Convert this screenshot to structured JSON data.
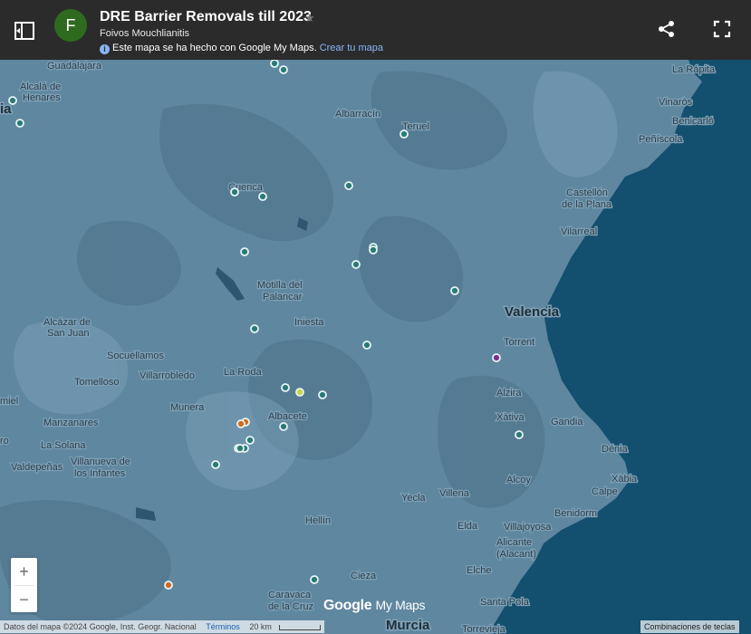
{
  "header": {
    "avatar_letter": "F",
    "title": "DRE Barrier Removals till 2023",
    "owner": "Foivos Mouchlianitis",
    "note": "Este mapa se ha hecho con Google My Maps.",
    "note_link": "Crear tu mapa"
  },
  "controls": {
    "zoom_in": "+",
    "zoom_out": "−"
  },
  "footer": {
    "attribution": "Datos del mapa ©2024 Google, Inst. Geogr. Nacional",
    "terms": "Términos",
    "scale": "20 km",
    "shortcuts": "Combinaciones de teclas"
  },
  "logo": {
    "google": "Google",
    "mymaps": "My Maps"
  },
  "colors": {
    "land": "#5f87a0",
    "land_dark": "#4d7189",
    "sea": "#134f6e",
    "marker_white": "#e8f3f3",
    "marker_teal": "#2a7a78",
    "marker_orange": "#d2691e",
    "marker_yellow": "#c8d640",
    "marker_purple": "#7b2d8e",
    "marker_cyan": "#5bc6d6"
  },
  "places": [
    {
      "name": "Guadalajara",
      "size": "md"
    },
    {
      "name": "Alcalá de",
      "size": "md"
    },
    {
      "name": "Henares",
      "size": "md"
    },
    {
      "name": "La Rápita",
      "size": "md"
    },
    {
      "name": "Vinaròs",
      "size": "md"
    },
    {
      "name": "Benicarló",
      "size": "md"
    },
    {
      "name": "Peñíscola",
      "size": "md"
    },
    {
      "name": "Albarracín",
      "size": "md"
    },
    {
      "name": "Teruel",
      "size": "md"
    },
    {
      "name": "Cuenca",
      "size": "md"
    },
    {
      "name": "Castellón",
      "size": "md"
    },
    {
      "name": "de la Plana",
      "size": "md"
    },
    {
      "name": "Vilarreal",
      "size": "md"
    },
    {
      "name": "Motilla del",
      "size": "md"
    },
    {
      "name": "Palancar",
      "size": "md"
    },
    {
      "name": "Valencia",
      "size": "lg"
    },
    {
      "name": "Alcázar de",
      "size": "md"
    },
    {
      "name": "San Juan",
      "size": "md"
    },
    {
      "name": "Iniesta",
      "size": "md"
    },
    {
      "name": "Torrent",
      "size": "md"
    },
    {
      "name": "Socuéllamos",
      "size": "md"
    },
    {
      "name": "Villarrobledo",
      "size": "md"
    },
    {
      "name": "Tomelloso",
      "size": "md"
    },
    {
      "name": "La Roda",
      "size": "md"
    },
    {
      "name": "Alzira",
      "size": "md"
    },
    {
      "name": "miel",
      "size": "md"
    },
    {
      "name": "Munera",
      "size": "md"
    },
    {
      "name": "Albacete",
      "size": "md"
    },
    {
      "name": "Xàtiva",
      "size": "md"
    },
    {
      "name": "Gandia",
      "size": "md"
    },
    {
      "name": "Manzanares",
      "size": "md"
    },
    {
      "name": "La Solana",
      "size": "md"
    },
    {
      "name": "Dénia",
      "size": "md"
    },
    {
      "name": "Valdepeñas",
      "size": "md"
    },
    {
      "name": "Villanueva de",
      "size": "md"
    },
    {
      "name": "los Infantes",
      "size": "md"
    },
    {
      "name": "Xàbia",
      "size": "md"
    },
    {
      "name": "Alcoy",
      "size": "md"
    },
    {
      "name": "Calpe",
      "size": "md"
    },
    {
      "name": "Yecla",
      "size": "md"
    },
    {
      "name": "Villena",
      "size": "md"
    },
    {
      "name": "Benidorm",
      "size": "md"
    },
    {
      "name": "Hellín",
      "size": "md"
    },
    {
      "name": "Elda",
      "size": "md"
    },
    {
      "name": "Villajoyosa",
      "size": "md"
    },
    {
      "name": "Alicante",
      "size": "md"
    },
    {
      "name": "(Alacant)",
      "size": "md"
    },
    {
      "name": "Elche",
      "size": "md"
    },
    {
      "name": "Cieza",
      "size": "md"
    },
    {
      "name": "Caravaca",
      "size": "md"
    },
    {
      "name": "de la Cruz",
      "size": "md"
    },
    {
      "name": "Santa Pola",
      "size": "md"
    },
    {
      "name": "Murcia",
      "size": "lg"
    },
    {
      "name": "Torrevieja",
      "size": "md"
    },
    {
      "name": "ia",
      "size": "lg"
    },
    {
      "name": "ro",
      "size": "md"
    }
  ],
  "markers": [
    {
      "color": "white"
    },
    {
      "color": "white"
    },
    {
      "color": "white"
    },
    {
      "color": "white"
    },
    {
      "color": "white"
    },
    {
      "color": "teal"
    },
    {
      "color": "white"
    },
    {
      "color": "white"
    },
    {
      "color": "white"
    },
    {
      "color": "white"
    },
    {
      "color": "white"
    },
    {
      "color": "white"
    },
    {
      "color": "white"
    },
    {
      "color": "white"
    },
    {
      "color": "purple"
    },
    {
      "color": "white"
    },
    {
      "color": "yellow"
    },
    {
      "color": "white"
    },
    {
      "color": "orange"
    },
    {
      "color": "orange"
    },
    {
      "color": "white"
    },
    {
      "color": "white"
    },
    {
      "color": "white"
    },
    {
      "color": "white"
    },
    {
      "color": "white"
    },
    {
      "color": "white"
    },
    {
      "color": "orange"
    },
    {
      "color": "white"
    },
    {
      "color": "white"
    },
    {
      "color": "white"
    }
  ]
}
